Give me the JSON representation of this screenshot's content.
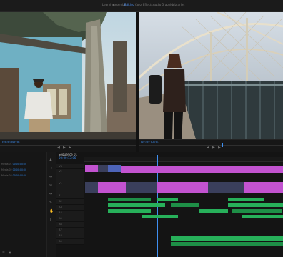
{
  "workspaces": [
    "Learning",
    "Assembly",
    "Editing",
    "Color",
    "Effects",
    "Audio",
    "Graphics",
    "Libraries"
  ],
  "active_workspace": "Editing",
  "program_monitor": {
    "title": "Program: Sequence 01"
  },
  "source_monitor": {
    "title": "Source"
  },
  "timecodes": {
    "source": "00:00:00:00",
    "program": "00:00:13:06"
  },
  "timeline": {
    "sequence_tab": "Sequence 01",
    "timecode": "00:00:13:06"
  },
  "project": {
    "rows": [
      {
        "name": "Media 01",
        "a": "00:00:00:00",
        "b": "00:00:09:12"
      },
      {
        "name": "Media 02",
        "a": "00:00:00:00",
        "b": "00:00:12:04"
      },
      {
        "name": "Media 03",
        "a": "00:00:00:00",
        "b": "00:00:07:18"
      }
    ]
  },
  "tracks": [
    "V3",
    "V2",
    "V1",
    "A1",
    "A2",
    "A3",
    "A4",
    "A5",
    "A6",
    "A7",
    "A8",
    "A9"
  ],
  "colors": {
    "accent": "#3f8ff0",
    "video_clip": "#c253d0",
    "audio_clip": "#27b05a",
    "playhead": "#3f8ff0"
  }
}
